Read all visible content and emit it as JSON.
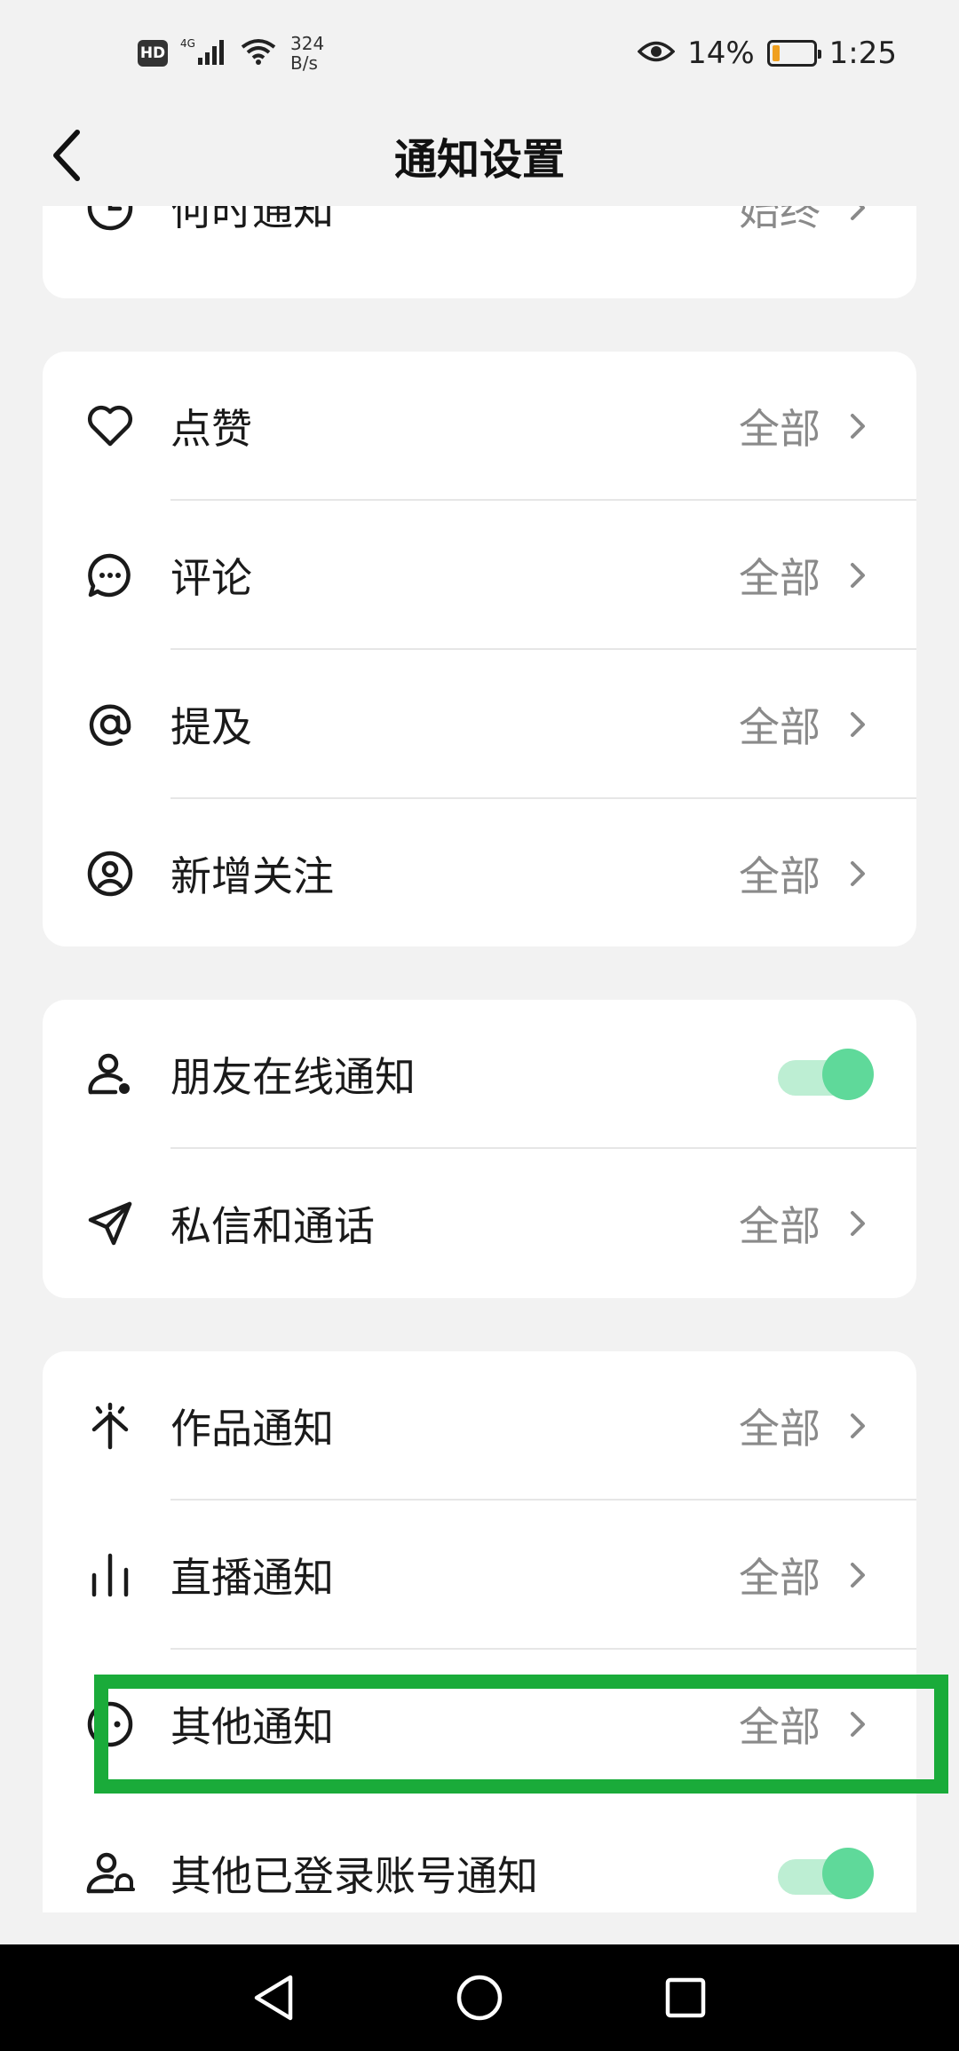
{
  "status_bar": {
    "hd": "HD",
    "network": "4G",
    "speed_value": "324",
    "speed_unit": "B/s",
    "battery_percent": "14%",
    "time": "1:25"
  },
  "header": {
    "title": "通知设置"
  },
  "cards": [
    {
      "rows": [
        {
          "label": "何时通知",
          "value": "始终",
          "icon": "clock-icon"
        }
      ]
    },
    {
      "rows": [
        {
          "label": "点赞",
          "value": "全部",
          "icon": "heart-icon"
        },
        {
          "label": "评论",
          "value": "全部",
          "icon": "comment-icon"
        },
        {
          "label": "提及",
          "value": "全部",
          "icon": "at-icon"
        },
        {
          "label": "新增关注",
          "value": "全部",
          "icon": "user-circle-icon"
        }
      ]
    },
    {
      "rows": [
        {
          "label": "朋友在线通知",
          "toggle": true,
          "icon": "user-online-icon"
        },
        {
          "label": "私信和通话",
          "value": "全部",
          "icon": "send-icon"
        }
      ]
    },
    {
      "rows": [
        {
          "label": "作品通知",
          "value": "全部",
          "icon": "sparkle-icon"
        },
        {
          "label": "直播通知",
          "value": "全部",
          "icon": "bars-icon"
        },
        {
          "label": "其他通知",
          "value": "全部",
          "icon": "more-circle-icon"
        },
        {
          "label": "其他已登录账号通知",
          "toggle": true,
          "icon": "user-bell-icon"
        }
      ]
    }
  ],
  "colors": {
    "accent_green": "#5fd99a",
    "highlight": "#1aab3a"
  }
}
